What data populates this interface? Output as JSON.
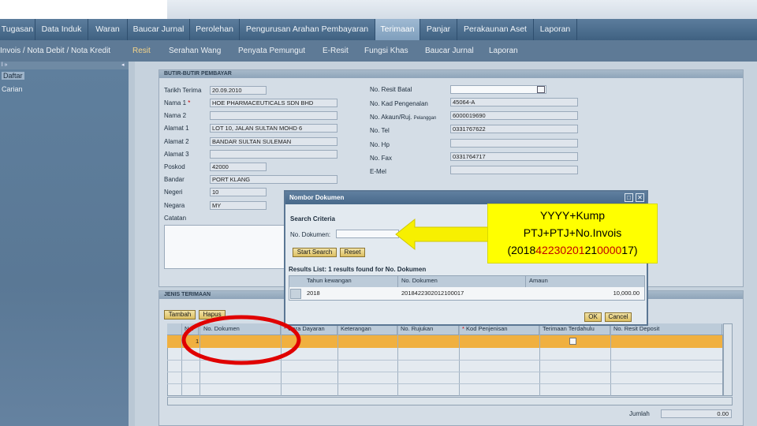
{
  "main_nav": [
    {
      "label": "Tugasan",
      "active": false
    },
    {
      "label": "Data Induk",
      "active": false
    },
    {
      "label": "Waran",
      "active": false
    },
    {
      "label": "Baucar Jurnal",
      "active": false
    },
    {
      "label": "Perolehan",
      "active": false
    },
    {
      "label": "Pengurusan Arahan Pembayaran",
      "active": false
    },
    {
      "label": "Terimaan",
      "active": true
    },
    {
      "label": "Panjar",
      "active": false
    },
    {
      "label": "Perakaunan Aset",
      "active": false
    },
    {
      "label": "Laporan",
      "active": false
    }
  ],
  "sub_nav": [
    {
      "label": "Invois / Nota Debit / Nota Kredit",
      "active": false
    },
    {
      "label": "Resit",
      "active": true
    },
    {
      "label": "Serahan Wang",
      "active": false
    },
    {
      "label": "Penyata Pemungut",
      "active": false
    },
    {
      "label": "E-Resit",
      "active": false
    },
    {
      "label": "Fungsi Khas",
      "active": false
    },
    {
      "label": "Baucar Jurnal",
      "active": false
    },
    {
      "label": "Laporan",
      "active": false
    }
  ],
  "left_panel": {
    "header_left": "l »",
    "header_right": "◂",
    "items": [
      "Daftar",
      "Carian"
    ]
  },
  "payer_panel": {
    "title": "BUTIR-BUTIR PEMBAYAR",
    "tarikh_terima": {
      "label": "Tarikh Terima",
      "value": "20.09.2010"
    },
    "nama1": {
      "label": "Nama 1",
      "value": "HOE PHARMACEUTICALS SDN BHD"
    },
    "nama2": {
      "label": "Nama 2",
      "value": ""
    },
    "alamat1": {
      "label": "Alamat 1",
      "value": "LOT 10, JALAN SULTAN MOHD 6"
    },
    "alamat2": {
      "label": "Alamat 2",
      "value": "BANDAR SULTAN SULEMAN"
    },
    "alamat3": {
      "label": "Alamat 3",
      "value": ""
    },
    "poskod": {
      "label": "Poskod",
      "value": "42000"
    },
    "bandar": {
      "label": "Bandar",
      "value": "PORT KLANG"
    },
    "negeri": {
      "label": "Negeri",
      "value": "10"
    },
    "negara": {
      "label": "Negara",
      "value": "MY"
    },
    "catatan": {
      "label": "Catatan"
    },
    "resit_batal": {
      "label": "No. Resit Batal",
      "value": ""
    },
    "kad_pengenalan": {
      "label": "No. Kad Pengenalan",
      "value": "45064-A"
    },
    "akaun_ruj": {
      "label": "No. Akaun/Ruj.",
      "label_small": "Pelanggan",
      "value": "6000019690"
    },
    "tel": {
      "label": "No. Tel",
      "value": "0331767622"
    },
    "hp": {
      "label": "No. Hp",
      "value": ""
    },
    "fax": {
      "label": "No. Fax",
      "value": "0331764717"
    },
    "emel": {
      "label": "E-Mel",
      "value": ""
    }
  },
  "dialog": {
    "title": "Nombor Dokumen",
    "search_criteria": "Search Criteria",
    "no_dokumen_label": "No. Dokumen:",
    "no_dokumen_value": "",
    "start_search": "Start Search",
    "reset": "Reset",
    "results_title": "Results List: 1 results found for No. Dokumen",
    "columns": [
      "Tahun kewangan",
      "No. Dokumen",
      "Amaun"
    ],
    "rows": [
      {
        "tahun": "2018",
        "dokumen": "2018422302012100017",
        "amaun": "10,000.00"
      }
    ],
    "ok": "OK",
    "cancel": "Cancel"
  },
  "terimaan_panel": {
    "title": "JENIS TERIMAAN",
    "tambah": "Tambah",
    "hapus": "Hapus",
    "columns": [
      "No.",
      "No. Dokumen",
      "Cara Dayaran",
      "Keterangan",
      "No. Rujukan",
      "Kod Penjenisan",
      "Terimaan Terdahulu",
      "No. Resit Deposit"
    ],
    "row_number": "1",
    "jumlah_label": "Jumlah",
    "jumlah_value": "0.00"
  },
  "callout": {
    "line1": "YYYY+Kump",
    "line2": "PTJ+PTJ+No.Invois",
    "open": "(",
    "seg_a": "2018",
    "seg_b": "42230201",
    "seg_c": "21",
    "seg_d": "0000",
    "seg_e": "17",
    "close": ")"
  },
  "colors": {
    "nav_bg": "#4a6b8b",
    "active_tab": "#8eacc8",
    "callout_bg": "#ffff00",
    "highlight_row": "#f0b040",
    "annotation_red": "#e00000"
  }
}
